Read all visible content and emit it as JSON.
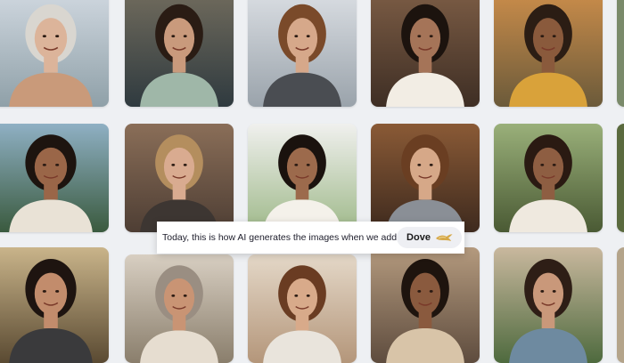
{
  "caption": {
    "text": "Today, this is how AI generates the images when we add",
    "brand_label": "Dove",
    "brand_icon": "dove-bird-icon"
  },
  "colors": {
    "background": "#eef0f3",
    "caption_bg": "#ffffff",
    "pill_bg": "#eeeff3",
    "dove_icon": "#d6a94a"
  },
  "tiles": [
    {
      "name": "photo-older-woman-smiling-street",
      "bg1": "#cfd7df",
      "bg2": "#8fa0a8",
      "hair": "#d9d6d0",
      "skin": "#dcb49a",
      "top": "#c99a7a"
    },
    {
      "name": "photo-woman-cafe-standing",
      "bg1": "#6f6a5c",
      "bg2": "#2f3a3f",
      "hair": "#2a1c14",
      "skin": "#c99a7c",
      "top": "#9fb7a8"
    },
    {
      "name": "photo-woman-wheelchair-city",
      "bg1": "#d9dde2",
      "bg2": "#9aa3ab",
      "hair": "#7a4a2a",
      "skin": "#d6a88a",
      "top": "#4a4d52"
    },
    {
      "name": "photo-woman-curly-hair-laughing",
      "bg1": "#7a5b44",
      "bg2": "#3e2e24",
      "hair": "#1c130e",
      "skin": "#a57458",
      "top": "#f2ede4"
    },
    {
      "name": "photo-woman-bicycle-park",
      "bg1": "#c98c4a",
      "bg2": "#6b5a3a",
      "hair": "#2b1d14",
      "skin": "#8a5a3c",
      "top": "#d9a23a"
    },
    {
      "name": "photo-woman-curly-updo-festival",
      "bg1": "#8fb0c4",
      "bg2": "#3a5a3e",
      "hair": "#1d140f",
      "skin": "#9a6648",
      "top": "#e9e2d6"
    },
    {
      "name": "photo-older-woman-curly-blonde",
      "bg1": "#8a6e58",
      "bg2": "#4e3e34",
      "hair": "#b48e5e",
      "skin": "#d9ab90",
      "top": "#3d3632"
    },
    {
      "name": "photo-woman-white-top-studio",
      "bg1": "#f0f0ee",
      "bg2": "#9fb98a",
      "hair": "#1a120e",
      "skin": "#9c6a4c",
      "top": "#f4f1ea"
    },
    {
      "name": "photo-woman-long-hair-cafe",
      "bg1": "#8a5a36",
      "bg2": "#3e2a1e",
      "hair": "#6a3e22",
      "skin": "#d6a888",
      "top": "#8a8f96"
    },
    {
      "name": "photo-woman-curly-hair-park-trees",
      "bg1": "#9ab07a",
      "bg2": "#4a5a34",
      "hair": "#2a1a12",
      "skin": "#8e5e42",
      "top": "#efe9df"
    },
    {
      "name": "photo-woman-long-dark-hair-outdoors",
      "bg1": "#c9b48a",
      "bg2": "#5a4a32",
      "hair": "#1e1410",
      "skin": "#c28c6c",
      "top": "#3a3a3c"
    },
    {
      "name": "photo-older-woman-grey-hair-street",
      "bg1": "#d8cfc2",
      "bg2": "#8a7e6c",
      "hair": "#9a8e82",
      "skin": "#c99474",
      "top": "#e6ddd0"
    },
    {
      "name": "photo-woman-wavy-hair-portrait",
      "bg1": "#e4d8c8",
      "bg2": "#b4967a",
      "hair": "#6a3c22",
      "skin": "#d8aa8a",
      "top": "#e9e4dc"
    },
    {
      "name": "photo-woman-headband-curly-hair",
      "bg1": "#b49a7e",
      "bg2": "#5e4c3e",
      "hair": "#1e140e",
      "skin": "#8a5a3e",
      "top": "#d8c4a8"
    },
    {
      "name": "photo-woman-market-overalls",
      "bg1": "#c9b89e",
      "bg2": "#4e6a3e",
      "hair": "#2e1e16",
      "skin": "#c9987a",
      "top": "#6e8aa0"
    }
  ]
}
